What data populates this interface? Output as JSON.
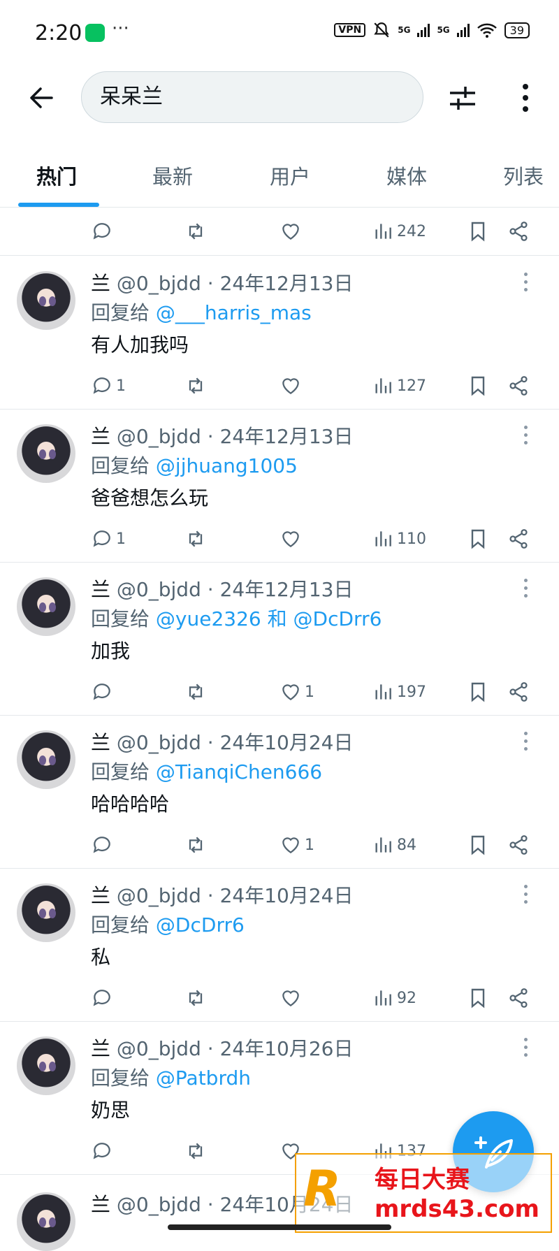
{
  "status_bar": {
    "time": "2:20",
    "vpn": "VPN",
    "signal1": "5G",
    "signal2": "5G",
    "battery": "39"
  },
  "search": {
    "query": "呆呆兰"
  },
  "tabs": [
    {
      "label": "热门"
    },
    {
      "label": "最新"
    },
    {
      "label": "用户"
    },
    {
      "label": "媒体"
    },
    {
      "label": "列表"
    }
  ],
  "top_actions": {
    "replies": "",
    "likes": "",
    "views": "242"
  },
  "tweets": [
    {
      "name": "兰",
      "handle": "@0_bjdd",
      "date": "24年12月13日",
      "reply_prefix": "回复给",
      "reply_to": "@___harris_mas",
      "reply_extra": "",
      "text": "有人加我吗",
      "replies": "1",
      "likes": "",
      "views": "127"
    },
    {
      "name": "兰",
      "handle": "@0_bjdd",
      "date": "24年12月13日",
      "reply_prefix": "回复给",
      "reply_to": "@jjhuang1005",
      "reply_extra": "",
      "text": "爸爸想怎么玩",
      "replies": "1",
      "likes": "",
      "views": "110"
    },
    {
      "name": "兰",
      "handle": "@0_bjdd",
      "date": "24年12月13日",
      "reply_prefix": "回复给",
      "reply_to": "@yue2326",
      "reply_extra": "和 @DcDrr6",
      "text": "加我",
      "replies": "",
      "likes": "1",
      "views": "197"
    },
    {
      "name": "兰",
      "handle": "@0_bjdd",
      "date": "24年10月24日",
      "reply_prefix": "回复给",
      "reply_to": "@TianqiChen666",
      "reply_extra": "",
      "text": "哈哈哈哈",
      "replies": "",
      "likes": "1",
      "views": "84"
    },
    {
      "name": "兰",
      "handle": "@0_bjdd",
      "date": "24年10月24日",
      "reply_prefix": "回复给",
      "reply_to": "@DcDrr6",
      "reply_extra": "",
      "text": "私",
      "replies": "",
      "likes": "",
      "views": "92"
    },
    {
      "name": "兰",
      "handle": "@0_bjdd",
      "date": "24年10月26日",
      "reply_prefix": "回复给",
      "reply_to": "@Patbrdh",
      "reply_extra": "",
      "text": "奶思",
      "replies": "",
      "likes": "",
      "views": "137"
    }
  ],
  "partial_tweet": {
    "name": "兰",
    "handle": "@0_bjdd",
    "date": "24年10月24日"
  },
  "watermark": {
    "logo": "R",
    "line1": "每日大赛",
    "line2": "mrds43.com"
  },
  "colors": {
    "accent": "#1d9bf0",
    "muted": "#536471",
    "watermark_red": "#e8151b",
    "watermark_gold": "#f4a000"
  }
}
